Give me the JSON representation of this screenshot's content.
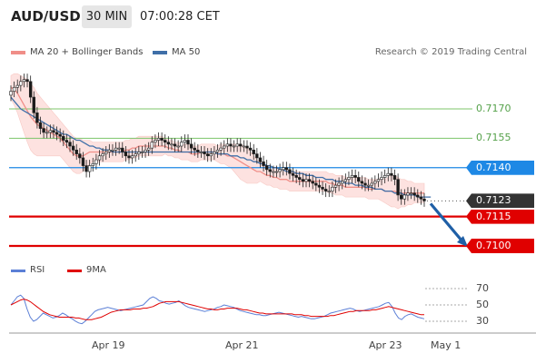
{
  "header": {
    "pair": "AUD/USD",
    "timeframe": "30 MIN",
    "time": "07:00:28 CET"
  },
  "legend": {
    "ma20_bollinger": "MA 20 + Bollinger Bands",
    "ma50": "MA 50",
    "credit": "Research © 2019 Trading Central"
  },
  "colors": {
    "up_candle": "#1a1a1a",
    "bollinger_fill": "#fde2e0",
    "ma20": "#f08e88",
    "ma50": "#3f6fa8",
    "support_red": "#e00000",
    "green_level": "#7cc46a",
    "blue_level": "#1e88e5",
    "rsi": "#5b7fd6",
    "rsi_ma": "#e00000"
  },
  "chart_data": [
    {
      "type": "line",
      "title": "AUD/USD 30 MIN",
      "xlabel": "",
      "ylabel": "",
      "x_ticks": [
        "Apr 19",
        "Apr 21",
        "Apr 23",
        "May 1"
      ],
      "ylim": [
        0.7094,
        0.7187
      ],
      "levels": [
        {
          "label": "0.7170",
          "value": 0.717,
          "style": "green"
        },
        {
          "label": "0.7155",
          "value": 0.7155,
          "style": "green"
        },
        {
          "label": "0.7140",
          "value": 0.714,
          "style": "blue"
        },
        {
          "label": "0.7123",
          "value": 0.7123,
          "style": "dark"
        },
        {
          "label": "0.7115",
          "value": 0.7115,
          "style": "red"
        },
        {
          "label": "0.7100",
          "value": 0.71,
          "style": "red"
        }
      ],
      "close": [
        0.7179,
        0.7181,
        0.7182,
        0.7184,
        0.7185,
        0.7184,
        0.7176,
        0.7168,
        0.7163,
        0.716,
        0.7158,
        0.7158,
        0.7159,
        0.7158,
        0.7157,
        0.7156,
        0.7154,
        0.7153,
        0.7151,
        0.7149,
        0.7147,
        0.7145,
        0.7141,
        0.7138,
        0.7141,
        0.7142,
        0.7144,
        0.7146,
        0.7147,
        0.7148,
        0.7149,
        0.7149,
        0.715,
        0.715,
        0.7148,
        0.7146,
        0.7145,
        0.7146,
        0.7147,
        0.7148,
        0.7148,
        0.7149,
        0.715,
        0.7153,
        0.7154,
        0.7155,
        0.7154,
        0.7153,
        0.7152,
        0.7152,
        0.7151,
        0.7151,
        0.7153,
        0.7154,
        0.7152,
        0.715,
        0.7149,
        0.7148,
        0.7148,
        0.7147,
        0.7146,
        0.7147,
        0.7148,
        0.7149,
        0.715,
        0.7151,
        0.7152,
        0.7151,
        0.7151,
        0.7152,
        0.7151,
        0.7151,
        0.715,
        0.7149,
        0.7147,
        0.7145,
        0.7143,
        0.7141,
        0.7139,
        0.7138,
        0.7138,
        0.7138,
        0.7139,
        0.714,
        0.7139,
        0.7137,
        0.7136,
        0.7135,
        0.7134,
        0.7133,
        0.7134,
        0.7133,
        0.7132,
        0.7131,
        0.713,
        0.7129,
        0.7128,
        0.7128,
        0.713,
        0.7131,
        0.7132,
        0.7133,
        0.7134,
        0.7135,
        0.7136,
        0.7135,
        0.7133,
        0.7132,
        0.7131,
        0.7131,
        0.7132,
        0.7133,
        0.7134,
        0.7135,
        0.7136,
        0.7137,
        0.7136,
        0.7134,
        0.7126,
        0.7124,
        0.7126,
        0.7127,
        0.7127,
        0.7126,
        0.7125,
        0.7124,
        0.7123
      ],
      "ma20": [
        0.7181,
        0.718,
        0.7178,
        0.7175,
        0.7172,
        0.7169,
        0.7166,
        0.7164,
        0.7162,
        0.7161,
        0.716,
        0.7159,
        0.7158,
        0.7157,
        0.7156,
        0.7155,
        0.7153,
        0.7151,
        0.7149,
        0.7147,
        0.7146,
        0.7146,
        0.7146,
        0.7147,
        0.7148,
        0.7148,
        0.7148,
        0.7148,
        0.7148,
        0.7148,
        0.7148,
        0.7148,
        0.7148,
        0.7148,
        0.7148,
        0.7149,
        0.7149,
        0.715,
        0.715,
        0.7151,
        0.7151,
        0.7151,
        0.7151,
        0.7151,
        0.7151,
        0.7151,
        0.7151,
        0.7151,
        0.715,
        0.715,
        0.7149,
        0.7149,
        0.7148,
        0.7148,
        0.7148,
        0.7147,
        0.7147,
        0.7147,
        0.7148,
        0.7148,
        0.7148,
        0.7148,
        0.7148,
        0.7147,
        0.7147,
        0.7147,
        0.7146,
        0.7146,
        0.7145,
        0.7144,
        0.7143,
        0.7142,
        0.7141,
        0.714,
        0.7139,
        0.7138,
        0.7138,
        0.7137,
        0.7136,
        0.7136,
        0.7135,
        0.7135,
        0.7134,
        0.7134,
        0.7134,
        0.7133,
        0.7133,
        0.7133,
        0.7133,
        0.7133,
        0.7133,
        0.7133,
        0.7133,
        0.7133,
        0.7133,
        0.7133,
        0.7133,
        0.7132,
        0.7132,
        0.7131,
        0.7131,
        0.7131,
        0.713,
        0.713,
        0.713,
        0.713,
        0.713,
        0.713,
        0.713,
        0.7129,
        0.7129,
        0.7129,
        0.7129,
        0.7129,
        0.7128,
        0.7128,
        0.7128,
        0.7128,
        0.7127,
        0.7127,
        0.7127,
        0.7127,
        0.7127,
        0.7127,
        0.7127,
        0.7127,
        0.7127
      ],
      "bb_width": [
        0.0006,
        0.0008,
        0.001,
        0.0012,
        0.0014,
        0.0016,
        0.0017,
        0.0017,
        0.0016,
        0.0015,
        0.0014,
        0.0013,
        0.0012,
        0.0011,
        0.001,
        0.0009,
        0.0009,
        0.0009,
        0.0009,
        0.0009,
        0.0009,
        0.0009,
        0.0008,
        0.0007,
        0.0006,
        0.0005,
        0.0005,
        0.0005,
        0.0005,
        0.0005,
        0.0005,
        0.0005,
        0.0005,
        0.0005,
        0.0005,
        0.0005,
        0.0005,
        0.0005,
        0.0005,
        0.0005,
        0.0005,
        0.0005,
        0.0005,
        0.0005,
        0.0005,
        0.0005,
        0.0005,
        0.0004,
        0.0004,
        0.0004,
        0.0004,
        0.0004,
        0.0004,
        0.0004,
        0.0004,
        0.0004,
        0.0004,
        0.0004,
        0.0004,
        0.0004,
        0.0004,
        0.0004,
        0.0004,
        0.0004,
        0.0005,
        0.0005,
        0.0005,
        0.0006,
        0.0007,
        0.0008,
        0.0009,
        0.0009,
        0.0009,
        0.0008,
        0.0007,
        0.0006,
        0.0005,
        0.0005,
        0.0005,
        0.0005,
        0.0005,
        0.0005,
        0.0005,
        0.0005,
        0.0005,
        0.0005,
        0.0005,
        0.0005,
        0.0005,
        0.0005,
        0.0005,
        0.0005,
        0.0005,
        0.0005,
        0.0005,
        0.0005,
        0.0005,
        0.0005,
        0.0005,
        0.0005,
        0.0005,
        0.0005,
        0.0005,
        0.0005,
        0.0005,
        0.0005,
        0.0005,
        0.0005,
        0.0005,
        0.0005,
        0.0005,
        0.0005,
        0.0005,
        0.0006,
        0.0006,
        0.0007,
        0.0008,
        0.0008,
        0.0008,
        0.0007,
        0.0007,
        0.0006,
        0.0006,
        0.0005,
        0.0005,
        0.0005,
        0.0005,
        0.0005
      ],
      "ma50": [
        0.7176,
        0.7174,
        0.7172,
        0.717,
        0.7169,
        0.7168,
        0.7167,
        0.7166,
        0.7165,
        0.7164,
        0.7163,
        0.7162,
        0.7161,
        0.716,
        0.7159,
        0.7158,
        0.7157,
        0.7157,
        0.7156,
        0.7155,
        0.7154,
        0.7154,
        0.7153,
        0.7152,
        0.7151,
        0.7151,
        0.715,
        0.715,
        0.7149,
        0.7149,
        0.7149,
        0.7148,
        0.7148,
        0.7148,
        0.7148,
        0.7148,
        0.7148,
        0.7148,
        0.7148,
        0.7148,
        0.7148,
        0.7148,
        0.7148,
        0.7148,
        0.7148,
        0.7148,
        0.7148,
        0.7148,
        0.7148,
        0.7148,
        0.7148,
        0.7148,
        0.7148,
        0.7148,
        0.7148,
        0.7148,
        0.7148,
        0.7148,
        0.7148,
        0.7148,
        0.7148,
        0.7148,
        0.7148,
        0.7147,
        0.7147,
        0.7147,
        0.7147,
        0.7146,
        0.7146,
        0.7146,
        0.7145,
        0.7145,
        0.7144,
        0.7144,
        0.7143,
        0.7143,
        0.7142,
        0.7142,
        0.7141,
        0.7141,
        0.714,
        0.714,
        0.7139,
        0.7139,
        0.7138,
        0.7138,
        0.7138,
        0.7137,
        0.7137,
        0.7137,
        0.7136,
        0.7136,
        0.7136,
        0.7135,
        0.7135,
        0.7135,
        0.7134,
        0.7134,
        0.7134,
        0.7133,
        0.7133,
        0.7133,
        0.7132,
        0.7132,
        0.7132,
        0.7131,
        0.7131,
        0.7131,
        0.713,
        0.713,
        0.713,
        0.7129,
        0.7129,
        0.7129,
        0.7128,
        0.7128,
        0.7128,
        0.7127,
        0.7127,
        0.7127,
        0.7126,
        0.7126,
        0.7126,
        0.7126,
        0.7125,
        0.7125,
        0.7125,
        0.7125,
        0.7125
      ],
      "forecast": [
        0.7123,
        0.71
      ]
    },
    {
      "type": "line",
      "title": "",
      "y_ticks": [
        "70",
        "50",
        "30"
      ],
      "ylim": [
        20,
        78
      ],
      "series": [
        {
          "name": "RSI",
          "values": [
            50,
            55,
            60,
            62,
            58,
            45,
            35,
            30,
            32,
            36,
            40,
            38,
            36,
            34,
            35,
            37,
            40,
            38,
            35,
            33,
            30,
            28,
            27,
            30,
            34,
            38,
            42,
            44,
            45,
            46,
            47,
            46,
            45,
            44,
            43,
            44,
            45,
            46,
            47,
            48,
            49,
            50,
            54,
            58,
            60,
            58,
            55,
            54,
            52,
            51,
            52,
            53,
            55,
            52,
            49,
            47,
            46,
            45,
            44,
            43,
            42,
            43,
            44,
            45,
            47,
            48,
            50,
            49,
            48,
            47,
            45,
            43,
            42,
            41,
            40,
            39,
            38,
            38,
            37,
            37,
            38,
            39,
            40,
            41,
            40,
            39,
            38,
            37,
            36,
            35,
            36,
            35,
            34,
            33,
            33,
            34,
            35,
            36,
            38,
            40,
            41,
            42,
            43,
            44,
            45,
            46,
            45,
            43,
            42,
            43,
            44,
            45,
            46,
            47,
            48,
            50,
            52,
            53,
            48,
            40,
            34,
            32,
            36,
            38,
            39,
            37,
            35,
            34,
            33
          ]
        },
        {
          "name": "9MA",
          "values": [
            50,
            52,
            54,
            56,
            57,
            56,
            54,
            51,
            48,
            45,
            42,
            40,
            38,
            37,
            36,
            35,
            35,
            35,
            35,
            35,
            34,
            34,
            33,
            32,
            32,
            32,
            33,
            34,
            35,
            37,
            39,
            41,
            42,
            43,
            44,
            44,
            44,
            44,
            45,
            45,
            45,
            46,
            46,
            47,
            48,
            50,
            52,
            53,
            54,
            54,
            54,
            54,
            54,
            53,
            52,
            51,
            50,
            49,
            48,
            47,
            46,
            45,
            45,
            44,
            44,
            45,
            45,
            46,
            46,
            46,
            46,
            45,
            44,
            44,
            43,
            42,
            41,
            40,
            40,
            39,
            39,
            39,
            39,
            39,
            39,
            39,
            39,
            39,
            38,
            38,
            38,
            37,
            37,
            36,
            36,
            36,
            36,
            36,
            36,
            37,
            37,
            38,
            39,
            40,
            41,
            42,
            42,
            43,
            43,
            43,
            43,
            43,
            44,
            44,
            45,
            46,
            47,
            48,
            47,
            46,
            45,
            44,
            43,
            42,
            41,
            40,
            39,
            38,
            38
          ]
        }
      ]
    }
  ],
  "rsi_legend": {
    "rsi": "RSI",
    "ma": "9MA"
  },
  "x_axis": {
    "labels": [
      "Apr 19",
      "Apr 21",
      "Apr 23",
      "May 1"
    ]
  }
}
